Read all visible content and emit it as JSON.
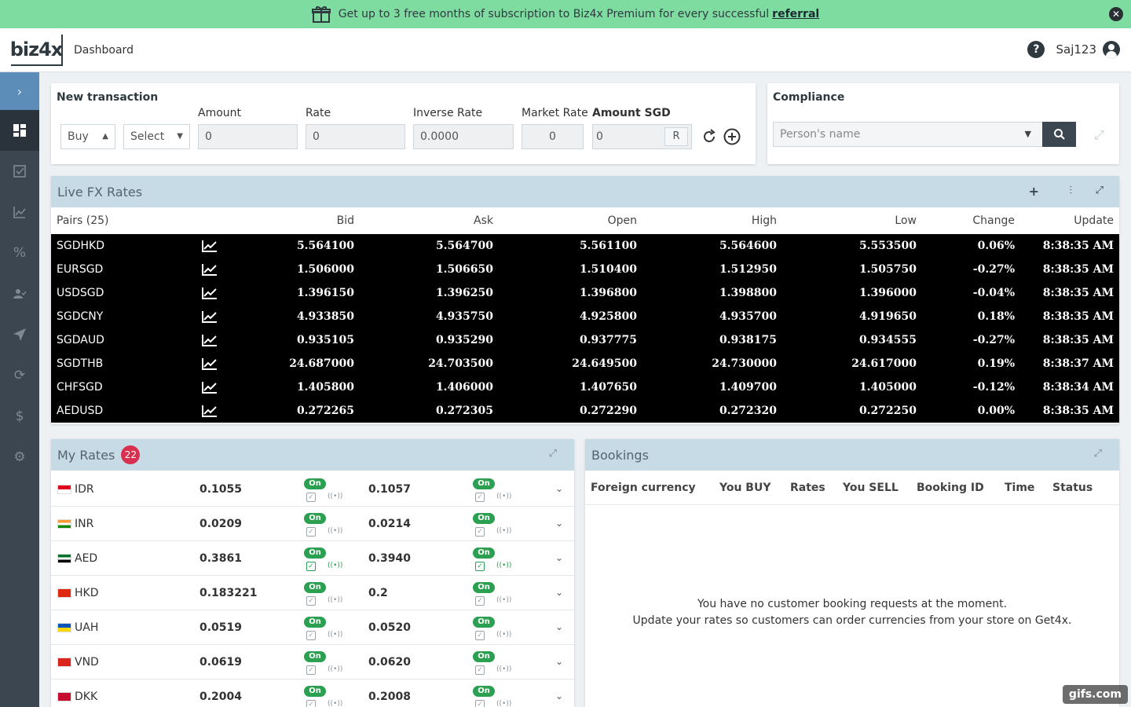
{
  "promo": {
    "text": "Get up to 3 free months of subscription to Biz4x Premium for every successful",
    "link": "referral",
    "close": "✕"
  },
  "header": {
    "logo": "biz4x",
    "title": "Dashboard",
    "help": "?",
    "username": "Saj123"
  },
  "sidebar": {
    "toggle": "›",
    "items": [
      "dashboard-icon",
      "checklist-icon",
      "chart-icon",
      "percent-icon",
      "users-icon",
      "send-icon",
      "refresh-icon",
      "dollar-icon",
      "gear-icon"
    ]
  },
  "new_transaction": {
    "title": "New transaction",
    "side": "Buy",
    "currency": "Select",
    "amount_label": "Amount",
    "amount": "0",
    "rate_label": "Rate",
    "rate": "0",
    "inverse_label": "Inverse Rate",
    "inverse": "0.0000",
    "market_label": "Market Rate",
    "market": "0",
    "amount_sgd_label": "Amount SGD",
    "amount_sgd": "0",
    "round_label": "R"
  },
  "compliance": {
    "title": "Compliance",
    "placeholder": "Person's name"
  },
  "fx": {
    "title": "Live FX Rates",
    "headers": {
      "pairs": "Pairs (25)",
      "bid": "Bid",
      "ask": "Ask",
      "open": "Open",
      "high": "High",
      "low": "Low",
      "change": "Change",
      "update": "Update"
    },
    "rows": [
      {
        "pair": "SGDHKD",
        "bid": "5.564100",
        "ask": "5.564700",
        "open": "5.561100",
        "high": "5.564600",
        "low": "5.553500",
        "change": "0.06%",
        "update": "8:38:35 AM"
      },
      {
        "pair": "EURSGD",
        "bid": "1.506000",
        "ask": "1.506650",
        "open": "1.510400",
        "high": "1.512950",
        "low": "1.505750",
        "change": "-0.27%",
        "update": "8:38:35 AM"
      },
      {
        "pair": "USDSGD",
        "bid": "1.396150",
        "ask": "1.396250",
        "open": "1.396800",
        "high": "1.398800",
        "low": "1.396000",
        "change": "-0.04%",
        "update": "8:38:35 AM"
      },
      {
        "pair": "SGDCNY",
        "bid": "4.933850",
        "ask": "4.935750",
        "open": "4.925800",
        "high": "4.935700",
        "low": "4.919650",
        "change": "0.18%",
        "update": "8:38:35 AM"
      },
      {
        "pair": "SGDAUD",
        "bid": "0.935105",
        "ask": "0.935290",
        "open": "0.937775",
        "high": "0.938175",
        "low": "0.934555",
        "change": "-0.27%",
        "update": "8:38:35 AM"
      },
      {
        "pair": "SGDTHB",
        "bid": "24.687000",
        "ask": "24.703500",
        "open": "24.649500",
        "high": "24.730000",
        "low": "24.617000",
        "change": "0.19%",
        "update": "8:38:37 AM"
      },
      {
        "pair": "CHFSGD",
        "bid": "1.405800",
        "ask": "1.406000",
        "open": "1.407650",
        "high": "1.409700",
        "low": "1.405000",
        "change": "-0.12%",
        "update": "8:38:34 AM"
      },
      {
        "pair": "AEDUSD",
        "bid": "0.272265",
        "ask": "0.272305",
        "open": "0.272290",
        "high": "0.272320",
        "low": "0.272250",
        "change": "0.00%",
        "update": "8:38:35 AM"
      }
    ]
  },
  "my_rates": {
    "title": "My Rates",
    "count": "22",
    "on_label": "On",
    "rows": [
      {
        "ccy": "IDR",
        "buy": "0.1055",
        "sell": "0.1057",
        "flag": [
          "#e0001b",
          "#ffffff"
        ],
        "green": false
      },
      {
        "ccy": "INR",
        "buy": "0.0209",
        "sell": "0.0214",
        "flag": [
          "#ff9933",
          "#ffffff",
          "#138808"
        ],
        "green": false
      },
      {
        "ccy": "AED",
        "buy": "0.3861",
        "sell": "0.3940",
        "flag": [
          "#00732f",
          "#ffffff",
          "#000000"
        ],
        "green": true
      },
      {
        "ccy": "HKD",
        "buy": "0.183221",
        "sell": "0.2",
        "flag": [
          "#de2910"
        ],
        "green": false
      },
      {
        "ccy": "UAH",
        "buy": "0.0519",
        "sell": "0.0520",
        "flag": [
          "#0057b7",
          "#ffd700"
        ],
        "green": false
      },
      {
        "ccy": "VND",
        "buy": "0.0619",
        "sell": "0.0620",
        "flag": [
          "#da251d"
        ],
        "green": false
      },
      {
        "ccy": "DKK",
        "buy": "0.2004",
        "sell": "0.2008",
        "flag": [
          "#c60c30"
        ],
        "green": false
      }
    ]
  },
  "bookings": {
    "title": "Bookings",
    "headers": [
      "Foreign currency",
      "You BUY",
      "Rates",
      "You SELL",
      "Booking ID",
      "Time",
      "Status"
    ],
    "empty_line1": "You have no customer booking requests at the moment.",
    "empty_line2": "Update your rates so customers can order currencies from your store on Get4x."
  },
  "watermark": "gifs.com"
}
